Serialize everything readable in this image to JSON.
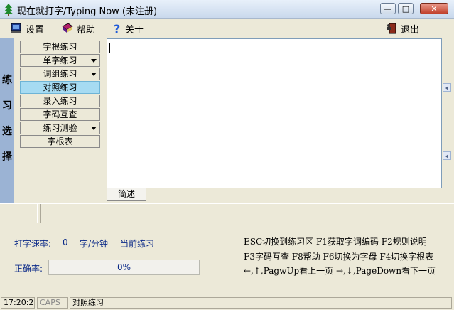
{
  "window": {
    "title": "现在就打字/Typing Now (未注册)",
    "buttons": {
      "minimize": "—",
      "maximize": "□",
      "close": "✕"
    }
  },
  "menu": {
    "settings": "设置",
    "help": "帮助",
    "about": "关于",
    "exit": "退出"
  },
  "sidebar": {
    "vertical_label": [
      "练",
      "习",
      "选",
      "择"
    ]
  },
  "practice_buttons": [
    {
      "label": "字根练习",
      "dropdown": false,
      "active": false
    },
    {
      "label": "单字练习",
      "dropdown": true,
      "active": false
    },
    {
      "label": "词组练习",
      "dropdown": true,
      "active": false
    },
    {
      "label": "对照练习",
      "dropdown": false,
      "active": true
    },
    {
      "label": "录入练习",
      "dropdown": false,
      "active": false
    },
    {
      "label": "字码互查",
      "dropdown": false,
      "active": false
    },
    {
      "label": "练习测验",
      "dropdown": true,
      "active": false
    },
    {
      "label": "字根表",
      "dropdown": false,
      "active": false
    }
  ],
  "tab_label": "简述",
  "stats": {
    "speed_label": "打字速率:",
    "speed_value": "0",
    "speed_unit": "字/分钟",
    "current_practice": "当前练习",
    "accuracy_label": "正确率:",
    "accuracy_text": "0%",
    "accuracy_fraction": 0
  },
  "help_lines": [
    "ESC切换到练习区  F1获取字词编码  F2规则说明",
    "F3字码互查  F8帮助  F6切换为字母 F4切换字根表",
    "←,↑,PagwUp看上一页  →,↓,PageDown看下一页"
  ],
  "statusbar": {
    "time": "17:20:2",
    "caps": "CAPS",
    "mode": "对照练习"
  },
  "colors": {
    "accent_active": "#a6dbf2",
    "stats_text": "#0b2a88",
    "side_strip": "#9bb3d4"
  }
}
